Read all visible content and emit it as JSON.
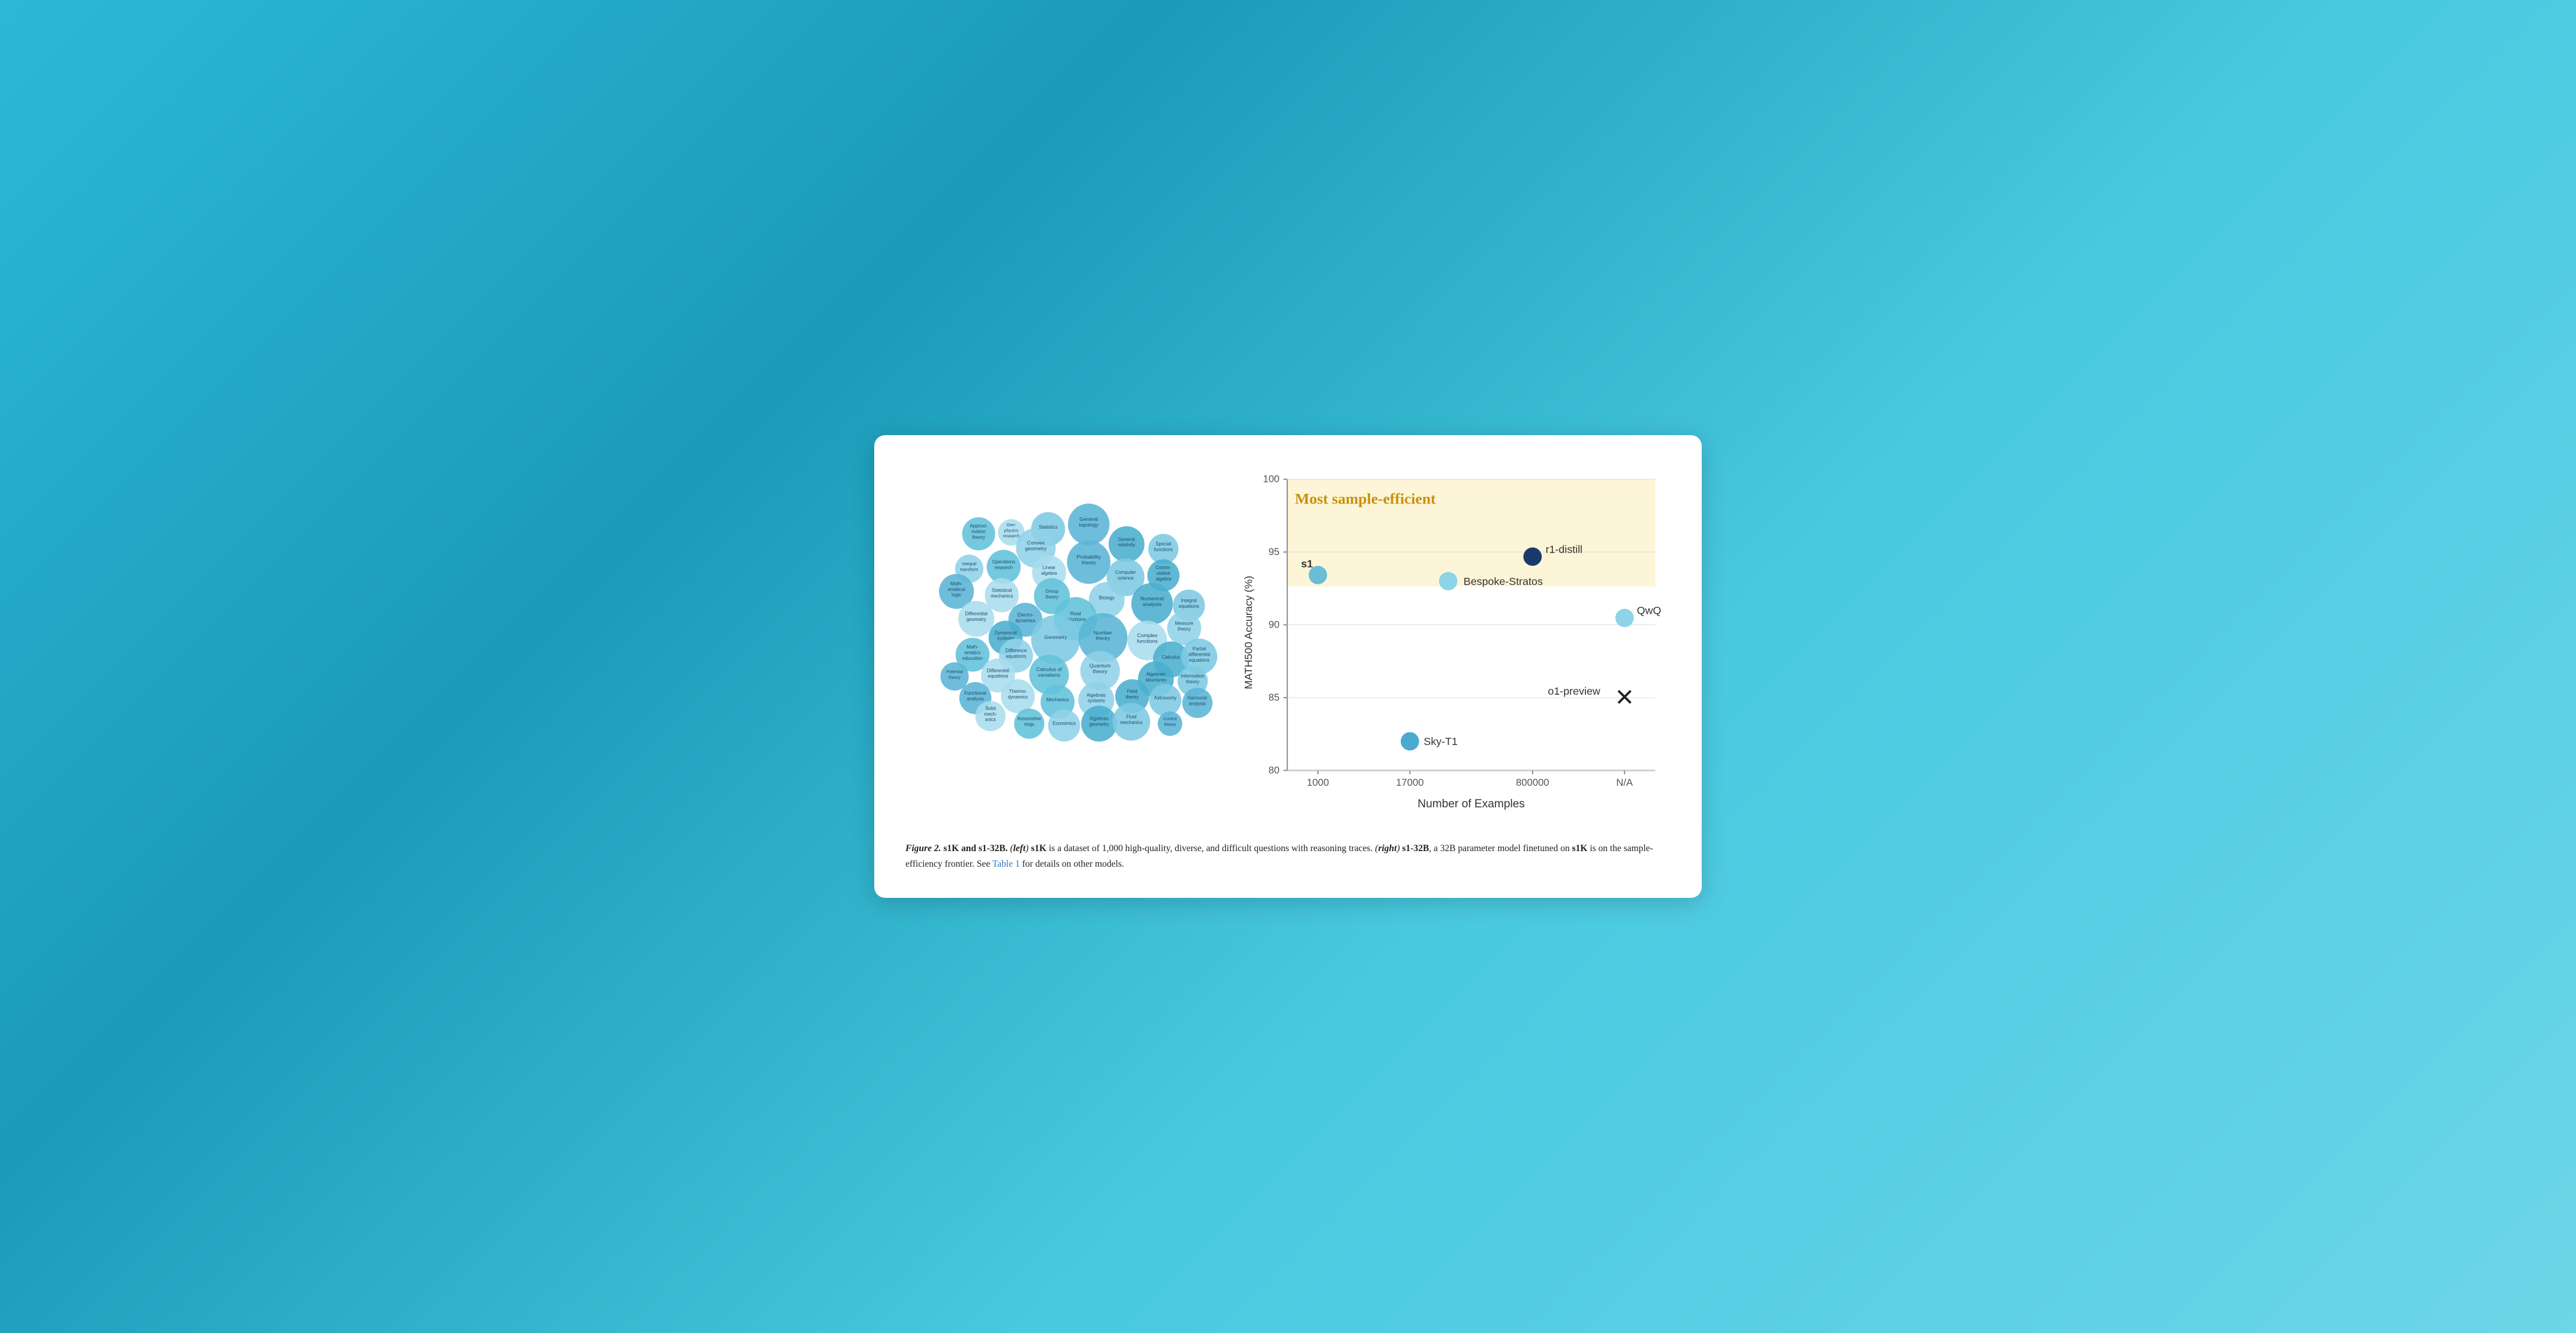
{
  "card": {
    "scatter": {
      "title": "Most sample-efficient",
      "x_label": "Number of Examples",
      "y_label": "MATH500 Accuracy (%)",
      "x_ticks": [
        "1000",
        "17000",
        "800000",
        "N/A"
      ],
      "y_ticks": [
        "80",
        "85",
        "90",
        "95",
        "100"
      ],
      "models": [
        {
          "label": "s1",
          "x": 1000,
          "type": "filled-light",
          "y": 93.4,
          "color": "#6bbcd6"
        },
        {
          "label": "Bespoke-Stratos",
          "x": 17000,
          "type": "filled-light",
          "y": 93.0,
          "color": "#8dd4e8"
        },
        {
          "label": "r1-distill",
          "x": 800000,
          "type": "filled-dark",
          "y": 94.7,
          "color": "#1a3a6e"
        },
        {
          "label": "QwQ",
          "x_na": true,
          "type": "filled-light",
          "y": 90.5,
          "color": "#8dd4e8"
        },
        {
          "label": "Sky-T1",
          "x": 17000,
          "type": "filled-medium",
          "y": 82.0,
          "color": "#4aabcf"
        },
        {
          "label": "o1-preview",
          "x_na": true,
          "type": "cross",
          "y": 85.5,
          "color": "#222"
        }
      ]
    },
    "caption": {
      "figure_num": "Figure 2.",
      "text": " s1K and s1-32B. (left) s1K is a dataset of 1,000 high-quality, diverse, and difficult questions with reasoning traces. (right) s1-32B, a 32B parameter model finetuned on s1K is on the sample-efficiency frontier. See Table 1 for details on other models."
    },
    "bubbles": [
      {
        "label": "Statistics",
        "cx": 302,
        "cy": 78,
        "r": 36
      },
      {
        "label": "General\ntopology",
        "cx": 388,
        "cy": 68,
        "r": 44
      },
      {
        "label": "Geo-\nphysics\nresearch",
        "cx": 224,
        "cy": 85,
        "r": 28
      },
      {
        "label": "Approxi-\nmation\ntheory",
        "cx": 155,
        "cy": 88,
        "r": 35
      },
      {
        "label": "Convex\ngeometry",
        "cx": 276,
        "cy": 118,
        "r": 42
      },
      {
        "label": "General\nrelativity",
        "cx": 468,
        "cy": 110,
        "r": 38
      },
      {
        "label": "Special\nfunctions",
        "cx": 546,
        "cy": 120,
        "r": 32
      },
      {
        "label": "Probability\ntheory",
        "cx": 388,
        "cy": 148,
        "r": 46
      },
      {
        "label": "Linear\nalgebra",
        "cx": 304,
        "cy": 170,
        "r": 36
      },
      {
        "label": "Operations\nresearch",
        "cx": 208,
        "cy": 158,
        "r": 36
      },
      {
        "label": "Integral\ntransform",
        "cx": 135,
        "cy": 162,
        "r": 30
      },
      {
        "label": "Comm-\nutative\nalgebra",
        "cx": 546,
        "cy": 176,
        "r": 34
      },
      {
        "label": "Computer\nscience",
        "cx": 466,
        "cy": 180,
        "r": 40
      },
      {
        "label": "Math-\nematical\nlogic",
        "cx": 108,
        "cy": 210,
        "r": 37
      },
      {
        "label": "Statistical\nmechanics",
        "cx": 204,
        "cy": 218,
        "r": 36
      },
      {
        "label": "Group\ntheory",
        "cx": 310,
        "cy": 220,
        "r": 38
      },
      {
        "label": "Biology",
        "cx": 426,
        "cy": 228,
        "r": 38
      },
      {
        "label": "Numerical\nanalysis",
        "cx": 522,
        "cy": 236,
        "r": 44
      },
      {
        "label": "Integral\nequations",
        "cx": 600,
        "cy": 240,
        "r": 34
      },
      {
        "label": "Electro-\ndynamics",
        "cx": 254,
        "cy": 270,
        "r": 36
      },
      {
        "label": "Differential\ngeometry",
        "cx": 150,
        "cy": 268,
        "r": 38
      },
      {
        "label": "Real\nfunctions",
        "cx": 360,
        "cy": 268,
        "r": 46
      },
      {
        "label": "Measure\ntheory",
        "cx": 590,
        "cy": 288,
        "r": 36
      },
      {
        "label": "Dynamical\nsystems",
        "cx": 212,
        "cy": 308,
        "r": 36
      },
      {
        "label": "Geometry",
        "cx": 318,
        "cy": 312,
        "r": 52
      },
      {
        "label": "Number\ntheory",
        "cx": 418,
        "cy": 308,
        "r": 52
      },
      {
        "label": "Complex\nfunctions",
        "cx": 512,
        "cy": 314,
        "r": 42
      },
      {
        "label": "Math-\nematics\neducation",
        "cx": 142,
        "cy": 344,
        "r": 36
      },
      {
        "label": "Difference\nequations",
        "cx": 234,
        "cy": 346,
        "r": 36
      },
      {
        "label": "Calculus",
        "cx": 562,
        "cy": 354,
        "r": 38
      },
      {
        "label": "Partial\ndifferential\nequations",
        "cx": 622,
        "cy": 348,
        "r": 38
      },
      {
        "label": "Potential\ntheory",
        "cx": 104,
        "cy": 390,
        "r": 30
      },
      {
        "label": "Differential\nequations",
        "cx": 196,
        "cy": 388,
        "r": 36
      },
      {
        "label": "Calculus of\nvariations",
        "cx": 304,
        "cy": 386,
        "r": 42
      },
      {
        "label": "Quantum\ntheory",
        "cx": 412,
        "cy": 378,
        "r": 42
      },
      {
        "label": "Algebraic\nstructures",
        "cx": 530,
        "cy": 396,
        "r": 38
      },
      {
        "label": "Information\ntheory",
        "cx": 608,
        "cy": 400,
        "r": 32
      },
      {
        "label": "Functional\nanalysis",
        "cx": 148,
        "cy": 436,
        "r": 34
      },
      {
        "label": "Thermo-\ndynamics",
        "cx": 238,
        "cy": 432,
        "r": 36
      },
      {
        "label": "Mechanics",
        "cx": 322,
        "cy": 444,
        "r": 36
      },
      {
        "label": "Algebraic\nsystems",
        "cx": 404,
        "cy": 440,
        "r": 38
      },
      {
        "label": "Field\ntheory",
        "cx": 480,
        "cy": 432,
        "r": 36
      },
      {
        "label": "Astronomy",
        "cx": 550,
        "cy": 440,
        "r": 34
      },
      {
        "label": "Harmonic\nanalysis",
        "cx": 618,
        "cy": 446,
        "r": 32
      },
      {
        "label": "Solid\nmech-\nanics",
        "cx": 180,
        "cy": 474,
        "r": 32
      },
      {
        "label": "Associative\nrings",
        "cx": 262,
        "cy": 490,
        "r": 32
      },
      {
        "label": "Economics",
        "cx": 336,
        "cy": 494,
        "r": 34
      },
      {
        "label": "Algebraic\ngeometry",
        "cx": 410,
        "cy": 490,
        "r": 38
      },
      {
        "label": "Fluid\nmechanics",
        "cx": 478,
        "cy": 486,
        "r": 40
      },
      {
        "label": "Control\ntheory",
        "cx": 560,
        "cy": 490,
        "r": 26
      }
    ]
  }
}
